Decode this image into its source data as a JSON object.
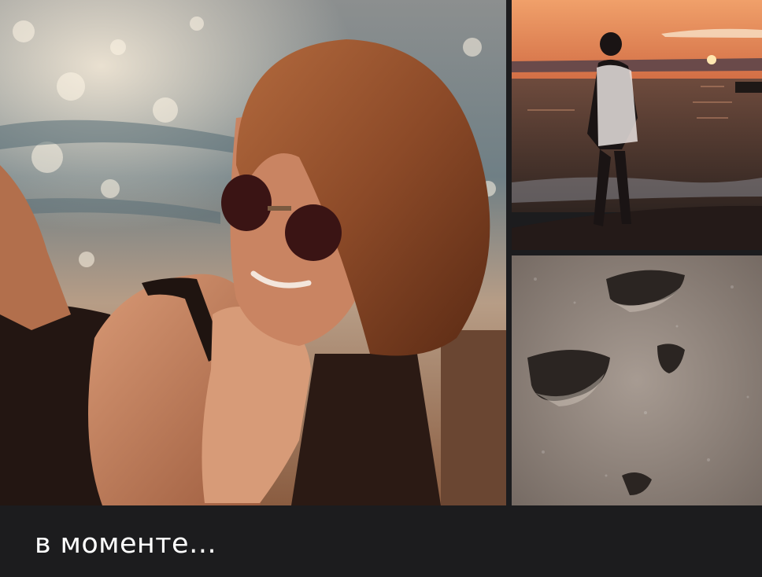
{
  "post": {
    "caption": "в моменте…"
  },
  "photos": [
    {
      "icon": "woman-sunglasses-photo"
    },
    {
      "icon": "sunset-silhouette-photo"
    },
    {
      "icon": "sand-footprints-photo"
    }
  ],
  "colors": {
    "background": "#1c1c1e",
    "caption_text": "#ffffff",
    "sunset_sky": "#e0925e",
    "sand": "#9c8f86"
  }
}
